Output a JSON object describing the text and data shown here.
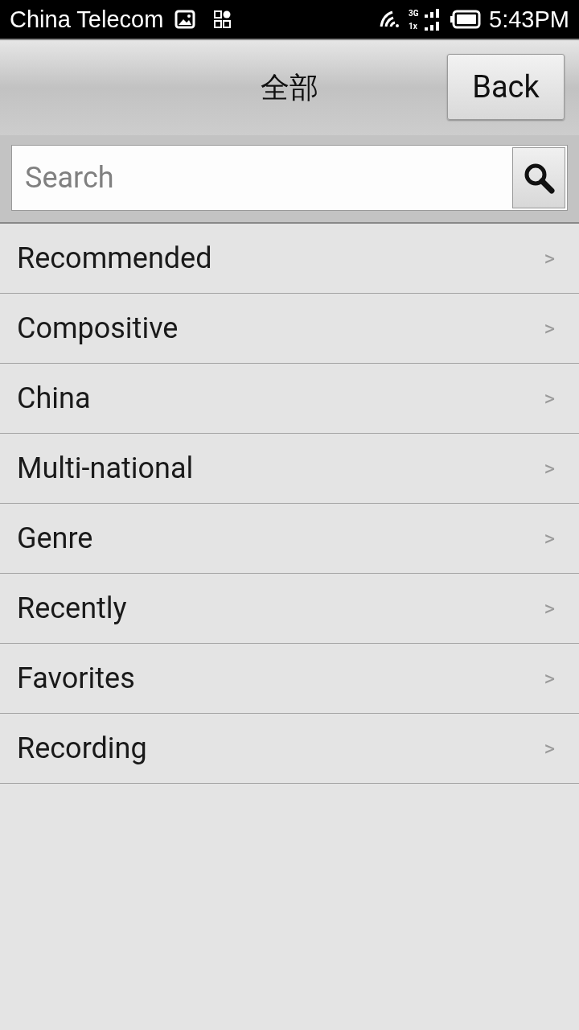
{
  "status_bar": {
    "carrier": "China Telecom",
    "network_top": "3G",
    "network_bottom": "1x",
    "time": "5:43PM"
  },
  "header": {
    "title": "全部",
    "back_button": "Back"
  },
  "search": {
    "placeholder": "Search"
  },
  "list": [
    {
      "label": "Recommended",
      "chevron": ">"
    },
    {
      "label": "Compositive",
      "chevron": ">"
    },
    {
      "label": "China",
      "chevron": ">"
    },
    {
      "label": "Multi-national",
      "chevron": ">"
    },
    {
      "label": "Genre",
      "chevron": ">"
    },
    {
      "label": "Recently",
      "chevron": ">"
    },
    {
      "label": "Favorites",
      "chevron": ">"
    },
    {
      "label": "Recording",
      "chevron": ">"
    }
  ]
}
